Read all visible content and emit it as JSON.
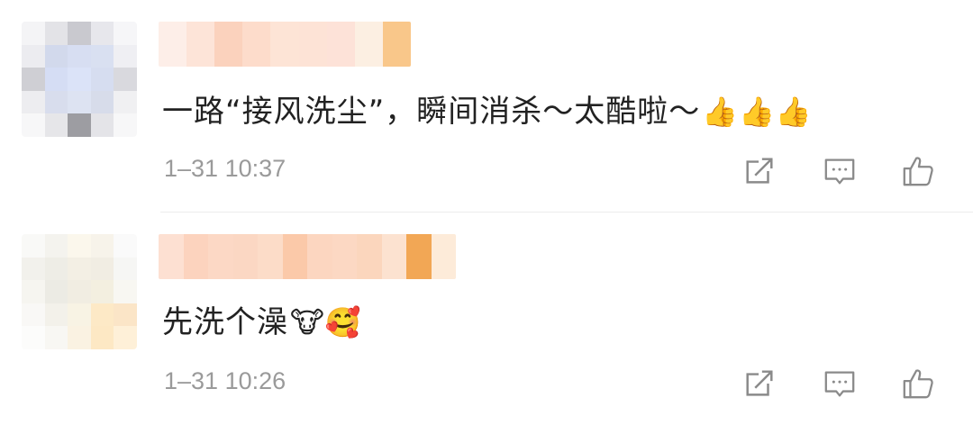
{
  "comments": [
    {
      "text": "一路“接风洗尘”，瞬间消杀～太酷啦～",
      "emoji": "👍👍👍",
      "time": "1–31 10:37"
    },
    {
      "text": "先洗个澡",
      "emoji": "🐮🥰",
      "time": "1–31 10:26"
    }
  ],
  "icons": {
    "share": "share-icon",
    "reply": "comment-icon",
    "like": "thumbs-up-icon"
  },
  "colors": {
    "text": "#222222",
    "meta": "#9a9a9a",
    "icon": "#8a8a8a"
  }
}
